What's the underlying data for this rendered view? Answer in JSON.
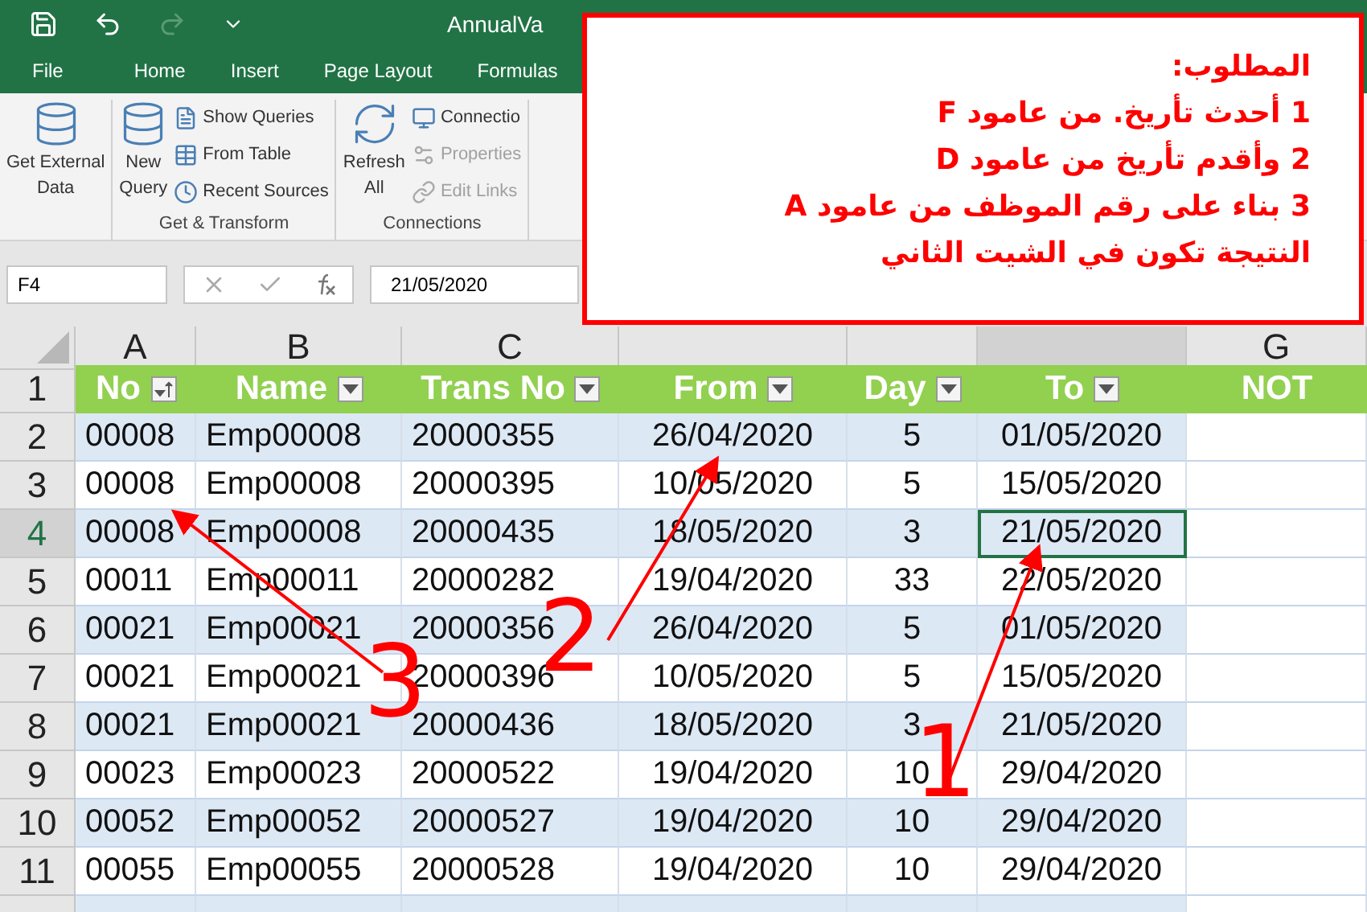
{
  "title_bar": {
    "title": "AnnualVa",
    "undo_enabled": true,
    "redo_enabled": false
  },
  "ribbon": {
    "tabs": [
      {
        "label": "File",
        "selected": false
      },
      {
        "label": "Home",
        "selected": false
      },
      {
        "label": "Insert",
        "selected": false
      },
      {
        "label": "Page Layout",
        "selected": false
      },
      {
        "label": "Formulas",
        "selected": false
      }
    ],
    "groups": [
      {
        "large": [
          {
            "label": "Get External",
            "label2": "Data",
            "disabled": false
          }
        ]
      },
      {
        "name": "Get & Transform",
        "large": [
          {
            "label": "New",
            "label2": "Query",
            "disabled": false
          }
        ],
        "small": [
          {
            "label": "Show Queries",
            "disabled": false
          },
          {
            "label": "From Table",
            "disabled": false
          },
          {
            "label": "Recent Sources",
            "disabled": false
          }
        ]
      },
      {
        "name": "Connections",
        "large": [
          {
            "label": "Refresh",
            "label2": "All",
            "disabled": false
          }
        ],
        "small": [
          {
            "label": "Connectio",
            "disabled": false
          },
          {
            "label": "Properties",
            "disabled": true
          },
          {
            "label": "Edit Links",
            "disabled": true
          }
        ]
      }
    ]
  },
  "name_box": "F4",
  "formula": "21/05/2020",
  "columns": [
    {
      "letter": "A",
      "selected": false
    },
    {
      "letter": "B",
      "selected": false
    },
    {
      "letter": "C",
      "selected": false
    },
    {
      "selected": false
    },
    {
      "selected": false
    },
    {
      "selected": true
    },
    {
      "letter": "G",
      "selected": false
    }
  ],
  "header_row": {
    "number": "1",
    "cells": [
      {
        "label": "No",
        "filter": true,
        "sorted": true
      },
      {
        "label": "Name",
        "filter": true,
        "sorted": false
      },
      {
        "label": "Trans No",
        "filter": true,
        "sorted": false
      },
      {
        "label": "From",
        "filter": true,
        "sorted": false
      },
      {
        "label": "Day",
        "filter": true,
        "sorted": false
      },
      {
        "label": "To",
        "filter": true,
        "sorted": false
      },
      {
        "label": "NOT",
        "filter": false
      }
    ]
  },
  "rows": [
    {
      "number": "2",
      "selected": false,
      "cells": [
        "00008",
        "Emp00008",
        "20000355",
        "26/04/2020",
        "5",
        "01/05/2020"
      ]
    },
    {
      "number": "3",
      "selected": false,
      "cells": [
        "00008",
        "Emp00008",
        "20000395",
        "10/05/2020",
        "5",
        "15/05/2020"
      ]
    },
    {
      "number": "4",
      "selected": true,
      "cells": [
        "00008",
        "Emp00008",
        "20000435",
        "18/05/2020",
        "3",
        "21/05/2020"
      ]
    },
    {
      "number": "5",
      "selected": false,
      "cells": [
        "00011",
        "Emp00011",
        "20000282",
        "19/04/2020",
        "33",
        "22/05/2020"
      ]
    },
    {
      "number": "6",
      "selected": false,
      "cells": [
        "00021",
        "Emp00021",
        "20000356",
        "26/04/2020",
        "5",
        "01/05/2020"
      ]
    },
    {
      "number": "7",
      "selected": false,
      "cells": [
        "00021",
        "Emp00021",
        "20000396",
        "10/05/2020",
        "5",
        "15/05/2020"
      ]
    },
    {
      "number": "8",
      "selected": false,
      "cells": [
        "00021",
        "Emp00021",
        "20000436",
        "18/05/2020",
        "3",
        "21/05/2020"
      ]
    },
    {
      "number": "9",
      "selected": false,
      "cells": [
        "00023",
        "Emp00023",
        "20000522",
        "19/04/2020",
        "10",
        "29/04/2020"
      ]
    },
    {
      "number": "10",
      "selected": false,
      "cells": [
        "00052",
        "Emp00052",
        "20000527",
        "19/04/2020",
        "10",
        "29/04/2020"
      ]
    },
    {
      "number": "11",
      "selected": false,
      "cells": [
        "00055",
        "Emp00055",
        "20000528",
        "19/04/2020",
        "10",
        "29/04/2020"
      ]
    }
  ],
  "note": {
    "lines": [
      "المطلوب:",
      "1 أحدث تأريخ. من عامود F",
      "2 وأقدم تأريخ من عامود D",
      "3 بناء على رقم الموظف من عامود A",
      "النتيجة تكون في الشيت الثاني"
    ]
  },
  "annotations": [
    {
      "label": "1"
    },
    {
      "label": "2"
    },
    {
      "label": "3"
    }
  ]
}
